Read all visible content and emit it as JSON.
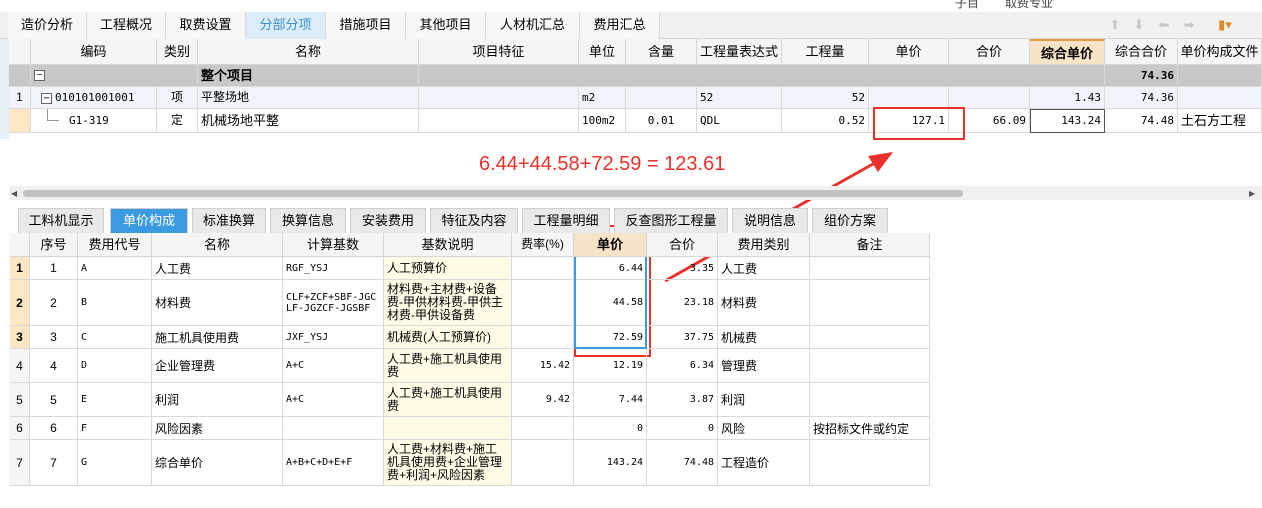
{
  "top_partial": {
    "a": "子目",
    "b": "取费专业"
  },
  "tabs": [
    "造价分析",
    "工程概况",
    "取费设置",
    "分部分项",
    "措施项目",
    "其他项目",
    "人材机汇总",
    "费用汇总"
  ],
  "active_tab": "分部分项",
  "upper_headers": [
    "编码",
    "类别",
    "名称",
    "项目特征",
    "单位",
    "含量",
    "工程量表达式",
    "工程量",
    "单价",
    "合价",
    "综合单价",
    "综合合价",
    "单价构成文件"
  ],
  "upper_rows": [
    {
      "num": "",
      "code": "",
      "type": "",
      "name": "整个项目",
      "feature": "",
      "unit": "",
      "qty_ratio": "",
      "expr": "",
      "qty": "",
      "unit_price": "",
      "total": "",
      "comp_price": "",
      "comp_total": "74.36",
      "file": ""
    },
    {
      "num": "1",
      "code": "010101001001",
      "type": "项",
      "name": "平整场地",
      "feature": "",
      "unit": "m2",
      "qty_ratio": "",
      "expr": "52",
      "qty": "52",
      "unit_price": "",
      "total": "",
      "comp_price": "1.43",
      "comp_total": "74.36",
      "file": ""
    },
    {
      "num": "",
      "code": "G1-319",
      "type": "定",
      "name": "机械场地平整",
      "feature": "",
      "unit": "100m2",
      "qty_ratio": "0.01",
      "expr": "QDL",
      "qty": "0.52",
      "unit_price": "127.1",
      "total": "66.09",
      "comp_price": "143.24",
      "comp_total": "74.48",
      "file": "土石方工程"
    }
  ],
  "annotation": "6.44+44.58+72.59 = 123.61",
  "bottom_tabs": [
    "工料机显示",
    "单价构成",
    "标准换算",
    "换算信息",
    "安装费用",
    "特征及内容",
    "工程量明细",
    "反查图形工程量",
    "说明信息",
    "组价方案"
  ],
  "active_bottom_tab": "单价构成",
  "lower_headers": [
    "序号",
    "费用代号",
    "名称",
    "计算基数",
    "基数说明",
    "费率(%)",
    "单价",
    "合价",
    "费用类别",
    "备注"
  ],
  "lower_rows": [
    {
      "row": "1",
      "seq": "1",
      "code": "A",
      "name": "人工费",
      "base": "RGF_YSJ",
      "desc": "人工预算价",
      "rate": "",
      "price": "6.44",
      "total": "3.35",
      "cat": "人工费",
      "note": ""
    },
    {
      "row": "2",
      "seq": "2",
      "code": "B",
      "name": "材料费",
      "base": "CLF+ZCF+SBF-JGCLF-JGZCF-JGSBF",
      "desc": "材料费+主材费+设备费-甲供材料费-甲供主材费-甲供设备费",
      "rate": "",
      "price": "44.58",
      "total": "23.18",
      "cat": "材料费",
      "note": ""
    },
    {
      "row": "3",
      "seq": "3",
      "code": "C",
      "name": "施工机具使用费",
      "base": "JXF_YSJ",
      "desc": "机械费(人工预算价)",
      "rate": "",
      "price": "72.59",
      "total": "37.75",
      "cat": "机械费",
      "note": ""
    },
    {
      "row": "4",
      "seq": "4",
      "code": "D",
      "name": "企业管理费",
      "base": "A+C",
      "desc": "人工费+施工机具使用费",
      "rate": "15.42",
      "price": "12.19",
      "total": "6.34",
      "cat": "管理费",
      "note": ""
    },
    {
      "row": "5",
      "seq": "5",
      "code": "E",
      "name": "利润",
      "base": "A+C",
      "desc": "人工费+施工机具使用费",
      "rate": "9.42",
      "price": "7.44",
      "total": "3.87",
      "cat": "利润",
      "note": ""
    },
    {
      "row": "6",
      "seq": "6",
      "code": "F",
      "name": "风险因素",
      "base": "",
      "desc": "",
      "rate": "",
      "price": "0",
      "total": "0",
      "cat": "风险",
      "note": "按招标文件或约定"
    },
    {
      "row": "7",
      "seq": "7",
      "code": "G",
      "name": "综合单价",
      "base": "A+B+C+D+E+F",
      "desc": "人工费+材料费+施工机具使用费+企业管理费+利润+风险因素",
      "rate": "",
      "price": "143.24",
      "total": "74.48",
      "cat": "工程造价",
      "note": ""
    }
  ],
  "colors": {
    "accent": "#3c9be0",
    "highlight_red": "#e8312a",
    "header_orange": "#f7e3c8"
  }
}
